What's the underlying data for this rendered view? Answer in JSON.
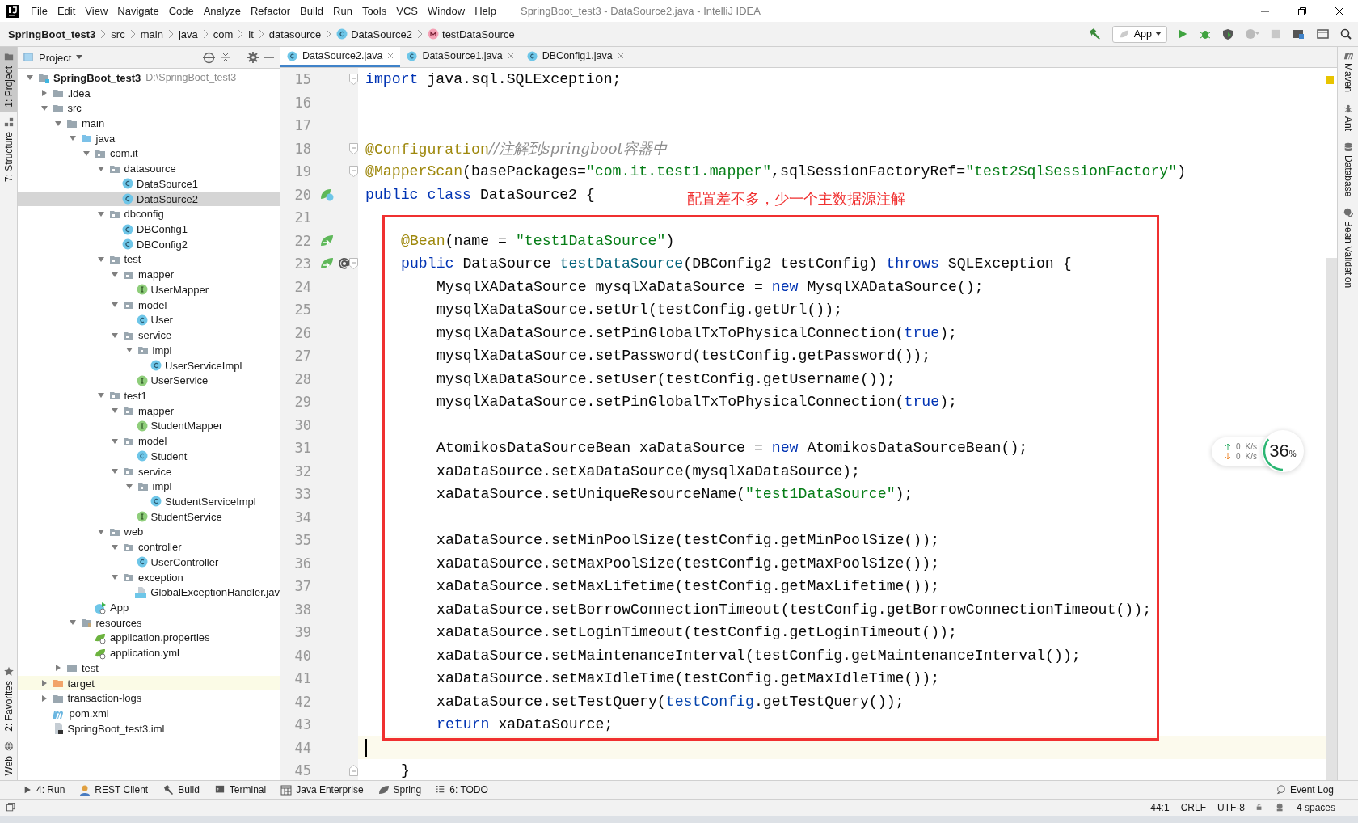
{
  "window": {
    "title": "SpringBoot_test3 - DataSource2.java - IntelliJ IDEA"
  },
  "menu": [
    "File",
    "Edit",
    "View",
    "Navigate",
    "Code",
    "Analyze",
    "Refactor",
    "Build",
    "Run",
    "Tools",
    "VCS",
    "Window",
    "Help"
  ],
  "breadcrumbs": [
    {
      "label": "SpringBoot_test3",
      "kind": "project"
    },
    {
      "label": "src",
      "kind": "dir"
    },
    {
      "label": "main",
      "kind": "dir"
    },
    {
      "label": "java",
      "kind": "dir"
    },
    {
      "label": "com",
      "kind": "dir"
    },
    {
      "label": "it",
      "kind": "dir"
    },
    {
      "label": "datasource",
      "kind": "dir"
    },
    {
      "label": "DataSource2",
      "kind": "class"
    },
    {
      "label": "testDataSource",
      "kind": "method"
    }
  ],
  "run_config": {
    "label": "App"
  },
  "left_strip": [
    {
      "label": "1: Project",
      "selected": true,
      "kind": "project"
    },
    {
      "label": "7: Structure",
      "selected": false,
      "kind": "structure"
    },
    {
      "label": "2: Favorites",
      "selected": false,
      "kind": "favorites"
    },
    {
      "label": "Web",
      "selected": false,
      "kind": "web"
    }
  ],
  "project_panel": {
    "title": "Project"
  },
  "tree": [
    {
      "label": "SpringBoot_test3",
      "path": "D:\\SpringBoot_test3",
      "kind": "module",
      "expanded": true,
      "selected": false,
      "children": [
        {
          "label": ".idea",
          "kind": "folder",
          "expanded": false,
          "selected": false
        },
        {
          "label": "src",
          "kind": "folder",
          "expanded": true,
          "selected": false,
          "children": [
            {
              "label": "main",
              "kind": "folder",
              "expanded": true,
              "selected": false,
              "children": [
                {
                  "label": "java",
                  "kind": "source",
                  "expanded": true,
                  "selected": false,
                  "children": [
                    {
                      "label": "com.it",
                      "kind": "package",
                      "expanded": true,
                      "selected": false,
                      "children": [
                        {
                          "label": "datasource",
                          "kind": "package",
                          "expanded": true,
                          "selected": false,
                          "children": [
                            {
                              "label": "DataSource1",
                              "kind": "class",
                              "selected": false
                            },
                            {
                              "label": "DataSource2",
                              "kind": "class",
                              "selected": true
                            }
                          ]
                        },
                        {
                          "label": "dbconfig",
                          "kind": "package",
                          "expanded": true,
                          "selected": false,
                          "children": [
                            {
                              "label": "DBConfig1",
                              "kind": "class",
                              "selected": false
                            },
                            {
                              "label": "DBConfig2",
                              "kind": "class",
                              "selected": false
                            }
                          ]
                        },
                        {
                          "label": "test",
                          "kind": "package",
                          "expanded": true,
                          "selected": false,
                          "children": [
                            {
                              "label": "mapper",
                              "kind": "package",
                              "expanded": true,
                              "selected": false,
                              "children": [
                                {
                                  "label": "UserMapper",
                                  "kind": "interface",
                                  "selected": false
                                }
                              ]
                            },
                            {
                              "label": "model",
                              "kind": "package",
                              "expanded": true,
                              "selected": false,
                              "children": [
                                {
                                  "label": "User",
                                  "kind": "class",
                                  "selected": false
                                }
                              ]
                            },
                            {
                              "label": "service",
                              "kind": "package",
                              "expanded": true,
                              "selected": false,
                              "children": [
                                {
                                  "label": "impl",
                                  "kind": "package",
                                  "expanded": true,
                                  "selected": false,
                                  "children": [
                                    {
                                      "label": "UserServiceImpl",
                                      "kind": "class",
                                      "selected": false
                                    }
                                  ]
                                },
                                {
                                  "label": "UserService",
                                  "kind": "interface",
                                  "selected": false
                                }
                              ]
                            }
                          ]
                        },
                        {
                          "label": "test1",
                          "kind": "package",
                          "expanded": true,
                          "selected": false,
                          "children": [
                            {
                              "label": "mapper",
                              "kind": "package",
                              "expanded": true,
                              "selected": false,
                              "children": [
                                {
                                  "label": "StudentMapper",
                                  "kind": "interface",
                                  "selected": false
                                }
                              ]
                            },
                            {
                              "label": "model",
                              "kind": "package",
                              "expanded": true,
                              "selected": false,
                              "children": [
                                {
                                  "label": "Student",
                                  "kind": "class",
                                  "selected": false
                                }
                              ]
                            },
                            {
                              "label": "service",
                              "kind": "package",
                              "expanded": true,
                              "selected": false,
                              "children": [
                                {
                                  "label": "impl",
                                  "kind": "package",
                                  "expanded": true,
                                  "selected": false,
                                  "children": [
                                    {
                                      "label": "StudentServiceImpl",
                                      "kind": "class",
                                      "selected": false
                                    }
                                  ]
                                },
                                {
                                  "label": "StudentService",
                                  "kind": "interface",
                                  "selected": false
                                }
                              ]
                            }
                          ]
                        },
                        {
                          "label": "web",
                          "kind": "package",
                          "expanded": true,
                          "selected": false,
                          "children": [
                            {
                              "label": "controller",
                              "kind": "package",
                              "expanded": true,
                              "selected": false,
                              "children": [
                                {
                                  "label": "UserController",
                                  "kind": "class",
                                  "selected": false
                                }
                              ]
                            },
                            {
                              "label": "exception",
                              "kind": "package",
                              "expanded": true,
                              "selected": false,
                              "children": [
                                {
                                  "label": "GlobalExceptionHandler.jav",
                                  "kind": "javafile",
                                  "selected": false
                                }
                              ]
                            }
                          ]
                        }
                      ]
                    },
                    {
                      "label": "App",
                      "kind": "app",
                      "selected": false
                    }
                  ]
                },
                {
                  "label": "resources",
                  "kind": "resources",
                  "expanded": true,
                  "selected": false,
                  "children": [
                    {
                      "label": "application.properties",
                      "kind": "config",
                      "selected": false
                    },
                    {
                      "label": "application.yml",
                      "kind": "config",
                      "selected": false
                    }
                  ]
                }
              ]
            },
            {
              "label": "test",
              "kind": "folder",
              "expanded": false,
              "selected": false
            }
          ]
        },
        {
          "label": "target",
          "kind": "excluded",
          "expanded": false,
          "selected": false
        },
        {
          "label": "transaction-logs",
          "kind": "folder",
          "expanded": false,
          "selected": false
        },
        {
          "label": "pom.xml",
          "kind": "maven",
          "selected": false
        },
        {
          "label": "SpringBoot_test3.iml",
          "kind": "iml",
          "selected": false
        }
      ]
    }
  ],
  "tabs": [
    {
      "label": "DataSource2.java",
      "selected": true
    },
    {
      "label": "DataSource1.java",
      "selected": false
    },
    {
      "label": "DBConfig1.java",
      "selected": false
    }
  ],
  "code": [
    {
      "number": "15",
      "kind": "top",
      "fold": {
        "kind": "start"
      },
      "current": false,
      "tokens": [
        {
          "kind": "keyword",
          "text": "import"
        },
        {
          "kind": "plain",
          "text": " java.sql.SQLException;"
        }
      ]
    },
    {
      "number": "16",
      "current": false
    },
    {
      "number": "17",
      "current": false
    },
    {
      "number": "18",
      "kind": "top",
      "fold": {
        "kind": "start"
      },
      "current": false,
      "tokens": [
        {
          "kind": "annotation",
          "text": "@Configuration"
        },
        {
          "kind": "comment",
          "text": "//注解到springboot容器中"
        }
      ]
    },
    {
      "number": "19",
      "kind": "top",
      "fold": {
        "kind": "start"
      },
      "current": false,
      "tokens": [
        {
          "kind": "annotation",
          "text": "@MapperScan"
        },
        {
          "kind": "plain",
          "text": "(basePackages="
        },
        {
          "kind": "string",
          "text": "\"com.it.test1.mapper\""
        },
        {
          "kind": "plain",
          "text": ",sqlSessionFactoryRef="
        },
        {
          "kind": "string",
          "text": "\"test2SqlSessionFactory\""
        },
        {
          "kind": "plain",
          "text": ")"
        }
      ]
    },
    {
      "number": "20",
      "kind": "top",
      "current": false,
      "gutter": [
        {
          "kind": "bean-class"
        }
      ],
      "tokens": [
        {
          "kind": "keyword",
          "text": "public class"
        },
        {
          "kind": "plain",
          "text": " DataSource2 {"
        }
      ]
    },
    {
      "number": "21",
      "current": false
    },
    {
      "number": "22",
      "kind": "member",
      "current": false,
      "gutter": [
        {
          "kind": "bean"
        }
      ],
      "tokens": [
        {
          "kind": "annotation",
          "text": "@Bean"
        },
        {
          "kind": "plain",
          "text": "(name = "
        },
        {
          "kind": "string",
          "text": "\"test1DataSource\""
        },
        {
          "kind": "plain",
          "text": ")"
        }
      ]
    },
    {
      "number": "23",
      "kind": "member",
      "fold": {
        "kind": "start"
      },
      "current": false,
      "gutter": [
        {
          "kind": "bean"
        },
        {
          "kind": "at"
        }
      ],
      "tokens": [
        {
          "kind": "keyword",
          "text": "public"
        },
        {
          "kind": "plain",
          "text": " DataSource "
        },
        {
          "kind": "method",
          "text": "testDataSource"
        },
        {
          "kind": "plain",
          "text": "(DBConfig2 testConfig) "
        },
        {
          "kind": "keyword",
          "text": "throws"
        },
        {
          "kind": "plain",
          "text": " SQLException {"
        }
      ]
    },
    {
      "number": "24",
      "kind": "body",
      "current": false,
      "tokens": [
        {
          "kind": "plain",
          "text": "MysqlXADataSource mysqlXaDataSource = "
        },
        {
          "kind": "keyword",
          "text": "new"
        },
        {
          "kind": "plain",
          "text": " MysqlXADataSource();"
        }
      ]
    },
    {
      "number": "25",
      "kind": "body",
      "current": false,
      "tokens": [
        {
          "kind": "plain",
          "text": "mysqlXaDataSource.setUrl(testConfig.getUrl());"
        }
      ]
    },
    {
      "number": "26",
      "kind": "body",
      "current": false,
      "tokens": [
        {
          "kind": "plain",
          "text": "mysqlXaDataSource.setPinGlobalTxToPhysicalConnection("
        },
        {
          "kind": "keyword",
          "text": "true"
        },
        {
          "kind": "plain",
          "text": ");"
        }
      ]
    },
    {
      "number": "27",
      "kind": "body",
      "current": false,
      "tokens": [
        {
          "kind": "plain",
          "text": "mysqlXaDataSource.setPassword(testConfig.getPassword());"
        }
      ]
    },
    {
      "number": "28",
      "kind": "body",
      "current": false,
      "tokens": [
        {
          "kind": "plain",
          "text": "mysqlXaDataSource.setUser(testConfig.getUsername());"
        }
      ]
    },
    {
      "number": "29",
      "kind": "body",
      "current": false,
      "tokens": [
        {
          "kind": "plain",
          "text": "mysqlXaDataSource.setPinGlobalTxToPhysicalConnection("
        },
        {
          "kind": "keyword",
          "text": "true"
        },
        {
          "kind": "plain",
          "text": ");"
        }
      ]
    },
    {
      "number": "30",
      "current": false
    },
    {
      "number": "31",
      "kind": "body",
      "current": false,
      "tokens": [
        {
          "kind": "plain",
          "text": "AtomikosDataSourceBean xaDataSource = "
        },
        {
          "kind": "keyword",
          "text": "new"
        },
        {
          "kind": "plain",
          "text": " AtomikosDataSourceBean();"
        }
      ]
    },
    {
      "number": "32",
      "kind": "body",
      "current": false,
      "tokens": [
        {
          "kind": "plain",
          "text": "xaDataSource.setXaDataSource(mysqlXaDataSource);"
        }
      ]
    },
    {
      "number": "33",
      "kind": "body",
      "current": false,
      "tokens": [
        {
          "kind": "plain",
          "text": "xaDataSource.setUniqueResourceName("
        },
        {
          "kind": "string",
          "text": "\"test1DataSource\""
        },
        {
          "kind": "plain",
          "text": ");"
        }
      ]
    },
    {
      "number": "34",
      "current": false
    },
    {
      "number": "35",
      "kind": "body",
      "current": false,
      "tokens": [
        {
          "kind": "plain",
          "text": "xaDataSource.setMinPoolSize(testConfig.getMinPoolSize());"
        }
      ]
    },
    {
      "number": "36",
      "kind": "body",
      "current": false,
      "tokens": [
        {
          "kind": "plain",
          "text": "xaDataSource.setMaxPoolSize(testConfig.getMaxPoolSize());"
        }
      ]
    },
    {
      "number": "37",
      "kind": "body",
      "current": false,
      "tokens": [
        {
          "kind": "plain",
          "text": "xaDataSource.setMaxLifetime(testConfig.getMaxLifetime());"
        }
      ]
    },
    {
      "number": "38",
      "kind": "body",
      "current": false,
      "tokens": [
        {
          "kind": "plain",
          "text": "xaDataSource.setBorrowConnectionTimeout(testConfig.getBorrowConnectionTimeout());"
        }
      ]
    },
    {
      "number": "39",
      "kind": "body",
      "current": false,
      "tokens": [
        {
          "kind": "plain",
          "text": "xaDataSource.setLoginTimeout(testConfig.getLoginTimeout());"
        }
      ]
    },
    {
      "number": "40",
      "kind": "body",
      "current": false,
      "tokens": [
        {
          "kind": "plain",
          "text": "xaDataSource.setMaintenanceInterval(testConfig.getMaintenanceInterval());"
        }
      ]
    },
    {
      "number": "41",
      "kind": "body",
      "current": false,
      "tokens": [
        {
          "kind": "plain",
          "text": "xaDataSource.setMaxIdleTime(testConfig.getMaxIdleTime());"
        }
      ]
    },
    {
      "number": "42",
      "kind": "body",
      "current": false,
      "tokens": [
        {
          "kind": "plain",
          "text": "xaDataSource.setTestQuery("
        },
        {
          "kind": "link",
          "text": "testConfig"
        },
        {
          "kind": "plain",
          "text": ".getTestQuery());"
        }
      ]
    },
    {
      "number": "43",
      "kind": "body",
      "current": false,
      "tokens": [
        {
          "kind": "keyword",
          "text": "return"
        },
        {
          "kind": "plain",
          "text": " xaDataSource;"
        }
      ]
    },
    {
      "number": "44",
      "current": true
    },
    {
      "number": "45",
      "kind": "member",
      "fold": {
        "kind": "end"
      },
      "current": false,
      "tokens": [
        {
          "kind": "plain",
          "text": "}"
        }
      ]
    }
  ],
  "annotation_note": "配置差不多，少一个主数据源注解",
  "right_strip": [
    {
      "label": "Maven",
      "kind": "maven"
    },
    {
      "label": "Ant",
      "kind": "ant"
    },
    {
      "label": "Database",
      "kind": "database"
    },
    {
      "label": "Bean Validation",
      "kind": "bean"
    }
  ],
  "network_widget": {
    "upload": "0",
    "upload_unit": "K/s",
    "download": "0",
    "download_unit": "K/s",
    "percent": "36",
    "percent_sign": "%",
    "level": 0.36
  },
  "bottom_tools": [
    {
      "label": "4: Run",
      "kind": "run"
    },
    {
      "label": "REST Client",
      "kind": "rest"
    },
    {
      "label": "Build",
      "kind": "build"
    },
    {
      "label": "Terminal",
      "kind": "terminal"
    },
    {
      "label": "Java Enterprise",
      "kind": "enterprise"
    },
    {
      "label": "Spring",
      "kind": "spring"
    },
    {
      "label": "6: TODO",
      "kind": "todo"
    }
  ],
  "event_log": "Event Log",
  "status_bar": {
    "position": "44:1",
    "line_separator": "CRLF",
    "encoding": "UTF-8",
    "indent": "4 spaces"
  }
}
